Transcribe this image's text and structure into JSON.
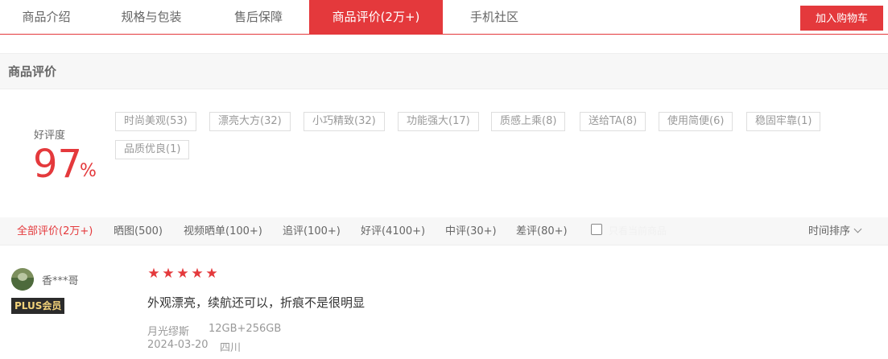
{
  "tabs": [
    {
      "label": "商品介绍"
    },
    {
      "label": "规格与包装"
    },
    {
      "label": "售后保障"
    },
    {
      "label": "商品评价(2万+)"
    },
    {
      "label": "手机社区"
    }
  ],
  "add_cart_label": "加入购物车",
  "section_title": "商品评价",
  "rating": {
    "label": "好评度",
    "value": "97",
    "unit": "%"
  },
  "tags": [
    "时尚美观(53)",
    "漂亮大方(32)",
    "小巧精致(32)",
    "功能强大(17)",
    "质感上乘(8)",
    "送给TA(8)",
    "使用简便(6)",
    "稳固牢靠(1)",
    "品质优良(1)"
  ],
  "filters": [
    "全部评价(2万+)",
    "晒图(500)",
    "视频晒单(100+)",
    "追评(100+)",
    "好评(4100+)",
    "中评(30+)",
    "差评(80+)"
  ],
  "only_current_label": "只看当前商品",
  "sort_label": "时间排序",
  "review": {
    "user": "香***哥",
    "badge": "PLUS会员",
    "stars": 5,
    "content": "外观漂亮，续航还可以，折痕不是很明显",
    "color": "月光缪斯",
    "spec": "12GB+256GB",
    "date": "2024-03-20",
    "location": "四川"
  },
  "colors": {
    "accent": "#e4393c"
  }
}
